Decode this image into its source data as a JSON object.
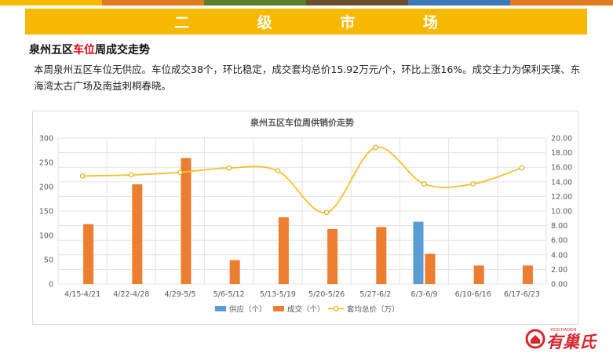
{
  "header": {
    "title": "二 级 市 场",
    "strip_colors": [
      "#f6b800",
      "#e07b1f",
      "#5b7f2a",
      "#6b4c2d",
      "#3c78b5",
      "#e07b1f",
      "#444444"
    ]
  },
  "section": {
    "title_prefix": "泉州五区",
    "title_highlight": "车位",
    "title_suffix": "周成交走势",
    "description": "本周泉州五区车位无供应。车位成交38个，环比稳定，成交套均总价15.92万元/个，环比上涨16%。成交主力为保利天璞、东海湾太古广场及南益刺桐春晓。"
  },
  "chart_data": {
    "type": "bar",
    "title": "泉州五区车位周供销价走势",
    "categories": [
      "4/15-4/21",
      "4/22-4/28",
      "4/29-5/5",
      "5/6-5/12",
      "5/13-5/19",
      "5/20-5/26",
      "5/27-6/2",
      "6/3-6/9",
      "6/10-6/16",
      "6/17-6/23"
    ],
    "series": [
      {
        "name": "供应（个）",
        "type": "bar",
        "axis": "left",
        "color": "#5b9bd5",
        "values": [
          0,
          0,
          0,
          0,
          0,
          0,
          0,
          128,
          0,
          0
        ]
      },
      {
        "name": "成交（个）",
        "type": "bar",
        "axis": "left",
        "color": "#ed7d31",
        "values": [
          123,
          205,
          259,
          49,
          137,
          113,
          117,
          62,
          38,
          38
        ]
      },
      {
        "name": "套均总价（万）",
        "type": "line",
        "axis": "right",
        "color": "#f2c12e",
        "values": [
          14.8,
          14.95,
          15.3,
          15.9,
          15.5,
          9.8,
          18.7,
          13.7,
          13.7,
          15.92
        ]
      }
    ],
    "ylim_left": [
      0,
      300
    ],
    "yticks_left": [
      "0",
      "50",
      "100",
      "150",
      "200",
      "250",
      "300"
    ],
    "ylim_right": [
      0,
      20
    ],
    "yticks_right": [
      "0.00",
      "2.00",
      "4.00",
      "6.00",
      "8.00",
      "10.00",
      "12.00",
      "14.00",
      "16.00",
      "18.00",
      "20.00"
    ],
    "grid": true,
    "legend_position": "bottom"
  },
  "logo": {
    "text": "有巢氏",
    "small_text": "YOUCHAOSHI"
  }
}
